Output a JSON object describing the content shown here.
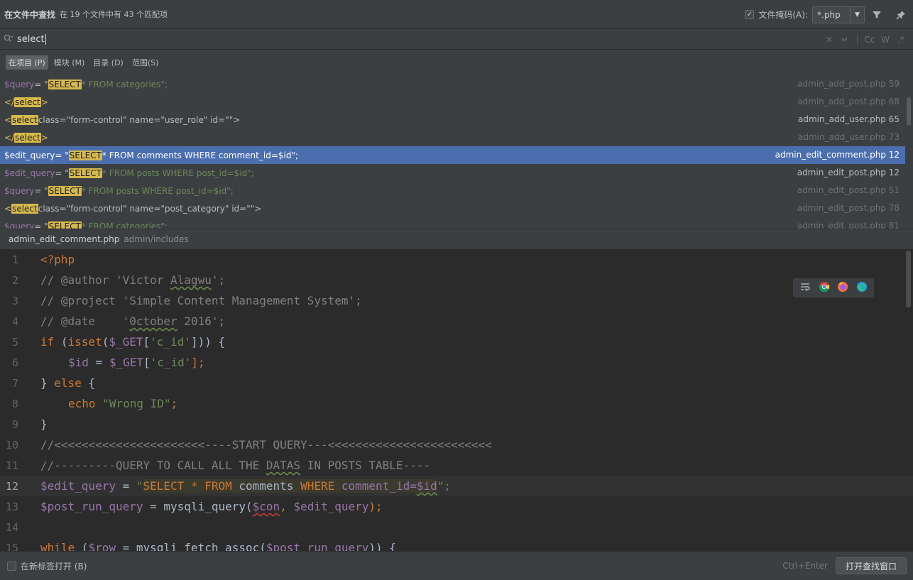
{
  "header": {
    "title": "在文件中查找",
    "summary": "在 19 个文件中有 43 个匹配项",
    "file_mask_label": "文件掩码(A):",
    "file_mask_value": "*.php",
    "file_mask_checked": true
  },
  "search": {
    "query": "select"
  },
  "scopes": [
    {
      "label": "在项目 (P)",
      "active": true
    },
    {
      "label": "模块 (M)",
      "active": false
    },
    {
      "label": "目录 (D)",
      "active": false
    },
    {
      "label": "范围(S)",
      "active": false
    }
  ],
  "results": [
    {
      "pre_var": "$query",
      "eq": " = \"",
      "match": "SELECT",
      "post": " * FROM categories\";",
      "file": "admin_add_post.php 59",
      "dim": true,
      "kind": "php"
    },
    {
      "pre": "</",
      "match": "select",
      "post": ">",
      "file": "admin_add_post.php 68",
      "dim": true,
      "kind": "html"
    },
    {
      "pre": "<",
      "match": "select",
      "post": " class=\"form-control\" name=\"user_role\" id=\"\">",
      "file": "admin_add_user.php 65",
      "dim": false,
      "kind": "html"
    },
    {
      "pre": "</",
      "match": "select",
      "post": ">",
      "file": "admin_add_user.php 73",
      "dim": true,
      "kind": "html"
    },
    {
      "pre_var": "$edit_query",
      "eq": " = \"",
      "match": "SELECT",
      "post": " * FROM comments WHERE comment_id=$id\";",
      "file": "admin_edit_comment.php 12",
      "dim": false,
      "kind": "php",
      "selected": true
    },
    {
      "pre_var": "$edit_query",
      "eq": " = \"",
      "match": "SELECT",
      "post": " * FROM posts WHERE post_id=$id\";",
      "file": "admin_edit_post.php 12",
      "dim": false,
      "kind": "php"
    },
    {
      "pre_var": "$query",
      "eq": " = \"",
      "match": "SELECT",
      "post": " * FROM posts WHERE post_id=$id\";",
      "file": "admin_edit_post.php 51",
      "dim": true,
      "kind": "php"
    },
    {
      "pre": "<",
      "match": "select",
      "post": " class=\"form-control\" name=\"post_category\" id=\"\">",
      "file": "admin_edit_post.php 78",
      "dim": true,
      "kind": "html"
    },
    {
      "pre_var": "$query",
      "eq": " = \"",
      "match": "SELECT",
      "post": " * FROM categories\";",
      "file": "admin_edit_post.php 81",
      "dim": true,
      "kind": "php"
    }
  ],
  "preview": {
    "file_name": "admin_edit_comment.php",
    "file_dir": "admin/includes"
  },
  "code_lines": [
    "1",
    "2",
    "3",
    "4",
    "5",
    "6",
    "7",
    "8",
    "9",
    "10",
    "11",
    "12",
    "13",
    "14",
    "15"
  ],
  "code": {
    "l1": "<?php",
    "l2a": "// @author 'Victor ",
    "l2b": "Alagwu",
    "l2c": "';",
    "l3": "// @project 'Simple Content Management System';",
    "l4a": "// @date    '",
    "l4b": "0ctober",
    "l4c": " 2016';",
    "l5a": "if",
    "l5b": " (",
    "l5c": "isset",
    "l5d": "(",
    "l5e": "$_GET",
    "l5f": "[",
    "l5g": "'c_id'",
    "l5h": "])) {",
    "l6a": "$id",
    "l6b": " = ",
    "l6c": "$_GET",
    "l6d": "[",
    "l6e": "'c_id'",
    "l6f": "];",
    "l7a": "} ",
    "l7b": "else",
    "l7c": " {",
    "l8a": "echo",
    "l8b": " \"Wrong ID\"",
    "l8c": ";",
    "l9": "}",
    "l10": "//<<<<<<<<<<<<<<<<<<<<<<----START QUERY---<<<<<<<<<<<<<<<<<<<<<<<<",
    "l11a": "//---------QUERY TO CALL ALL THE ",
    "l11b": "DATAS",
    "l11c": " IN POSTS TABLE----",
    "l12a": "$edit_query",
    "l12b": " = ",
    "l12c": "\"",
    "l12d": "SELECT * FROM",
    "l12e": " comments ",
    "l12f": "WHERE",
    "l12g": " comment_id=",
    "l12h": "$id",
    "l12i": "\";",
    "l13a": "$post_run_query",
    "l13b": " = mysqli_query(",
    "l13c": "$con",
    "l13d": ", ",
    "l13e": "$edit_query",
    "l13f": ");",
    "l15a": "while",
    "l15b": " (",
    "l15c": "$row",
    "l15d": " = mysqli_fetch_assoc(",
    "l15e": "$post_run_query",
    "l15f": ")) {"
  },
  "footer": {
    "new_tab_label": "在新标签打开 (B)",
    "shortcut": "Ctrl+Enter",
    "open_button": "打开查找窗口"
  },
  "colors": {
    "selection": "#4b6eaf",
    "match_highlight": "#d5b94c",
    "editor_bg": "#2b2b2b",
    "panel_bg": "#3c3f41"
  },
  "icons": [
    "search-icon",
    "filter-icon",
    "pin-icon",
    "clear-icon",
    "newline-icon",
    "match-case-icon",
    "words-icon",
    "regex-icon",
    "soft-wrap-icon",
    "chrome-icon",
    "firefox-icon",
    "edge-icon"
  ]
}
